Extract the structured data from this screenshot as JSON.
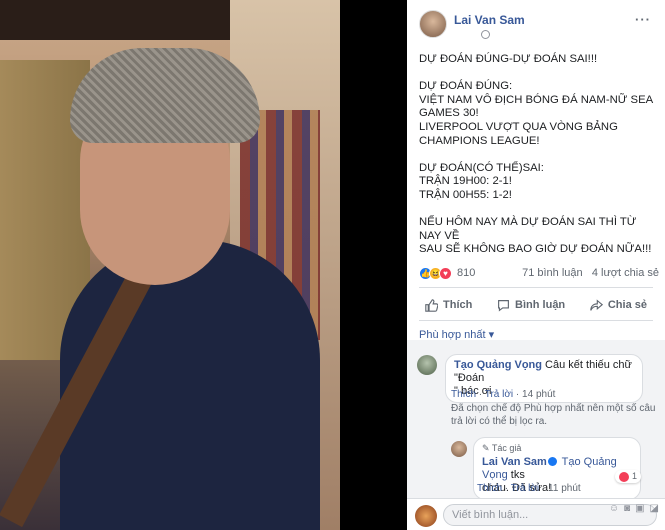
{
  "post": {
    "author": "Lai Van Sam",
    "more_label": "···",
    "lines": [
      [
        "DỰ ĐOÁN ĐÚNG-DỰ ĐOÁN SAI!!!"
      ],
      [
        "DỰ ĐOÁN ĐÚNG:",
        "VIỆT NAM VÔ ĐỊCH BÓNG ĐÁ NAM-NỮ SEA",
        "GAMES 30!",
        "LIVERPOOL VƯỢT QUA VÒNG BẢNG",
        "CHAMPIONS LEAGUE!"
      ],
      [
        "DỰ ĐOÁN(CÓ THỂ)SAI:",
        "TRẬN 19H00: 2-1!",
        "TRẬN 00H55: 1-2!"
      ],
      [
        "NẾU HÔM NAY MÀ DỰ ĐOÁN SAI THÌ TỪ NAY VỀ",
        "SAU SẼ KHÔNG BAO GIỜ DỰ ĐOÁN NỮA!!!"
      ]
    ]
  },
  "reactions": {
    "count": "810",
    "comments": "71 bình luận",
    "shares": "4 lượt chia sẻ"
  },
  "actions": {
    "like": "Thích",
    "comment": "Bình luận",
    "share": "Chia sẻ"
  },
  "sort_label": "Phù hợp nhất ▾",
  "comments": {
    "c1": {
      "name": "Tạo Quảng Vọng",
      "text_a": " Câu kết thiếu chữ \"Đoán",
      "text_b": "\" bác ơi",
      "like": "Thích",
      "reply": "Trả lời",
      "time": "14 phút"
    },
    "note": "Đã chọn chế độ Phù hợp nhất nên một số câu trả lời có thể bị lọc ra.",
    "reply": {
      "badge": "Tác giả",
      "name": "Lai Van Sam",
      "mention": "Tạo Quảng Vọng",
      "text_a": " tks",
      "text_b": "cháu. Đã sửa!",
      "like": "Thích",
      "reply": "Trả lời",
      "time": "11 phút",
      "hearts": "1"
    }
  },
  "composer": {
    "placeholder": "Viết bình luận..."
  },
  "colors": {
    "link": "#385898",
    "like_blue": "#1877f2",
    "love_red": "#f33e58"
  }
}
